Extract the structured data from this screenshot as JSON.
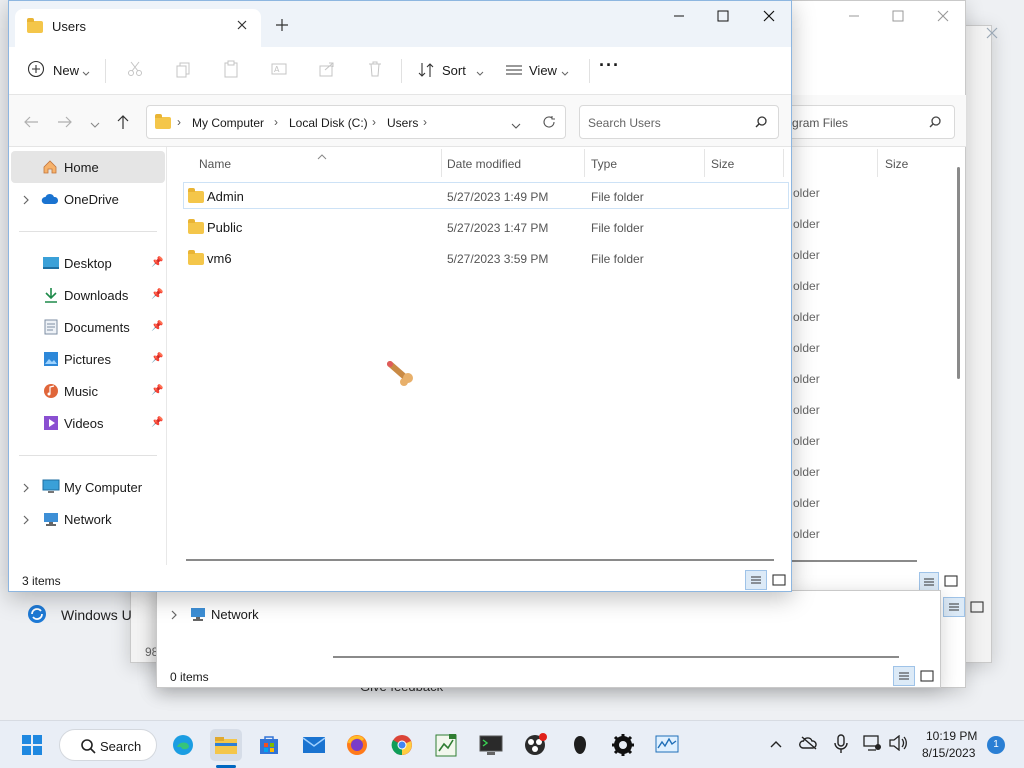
{
  "main_window": {
    "tab_title": "Users",
    "toolbar": {
      "new_label": "New",
      "sort_label": "Sort",
      "view_label": "View",
      "more_label": "···"
    },
    "breadcrumb": [
      "My Computer",
      "Local Disk (C:)",
      "Users"
    ],
    "search_placeholder": "Search Users",
    "columns": {
      "name": "Name",
      "date_modified": "Date modified",
      "type": "Type",
      "size": "Size"
    },
    "files": [
      {
        "name": "Admin",
        "date": "5/27/2023 1:49 PM",
        "type": "File folder"
      },
      {
        "name": "Public",
        "date": "5/27/2023 1:47 PM",
        "type": "File folder"
      },
      {
        "name": "vm6",
        "date": "5/27/2023 3:59 PM",
        "type": "File folder"
      }
    ],
    "nav": {
      "home": "Home",
      "onedrive": "OneDrive",
      "quick": [
        "Desktop",
        "Downloads",
        "Documents",
        "Pictures",
        "Music",
        "Videos"
      ],
      "my_computer": "My Computer",
      "network": "Network"
    },
    "status_items": "3 items"
  },
  "background_window_b": {
    "search_placeholder": "Search Program Files",
    "size_header": "Size",
    "type_fragments": [
      "older",
      "older",
      "older",
      "older",
      "older",
      "older",
      "older",
      "older",
      "older",
      "older",
      "older",
      "older"
    ]
  },
  "background_window_c": {
    "nav_network": "Network",
    "status_items": "0 items"
  },
  "background_window_a": {
    "windows_update_label": "Windows U",
    "partial_number": "98",
    "give_feedback": "Give feedback"
  },
  "taskbar": {
    "search_label": "Search",
    "time": "10:19 PM",
    "date": "8/15/2023",
    "notification_count": "1"
  },
  "colors": {
    "accent": "#0067c0",
    "folder": "#f4c64a",
    "taskbar": "#e9eef6"
  }
}
